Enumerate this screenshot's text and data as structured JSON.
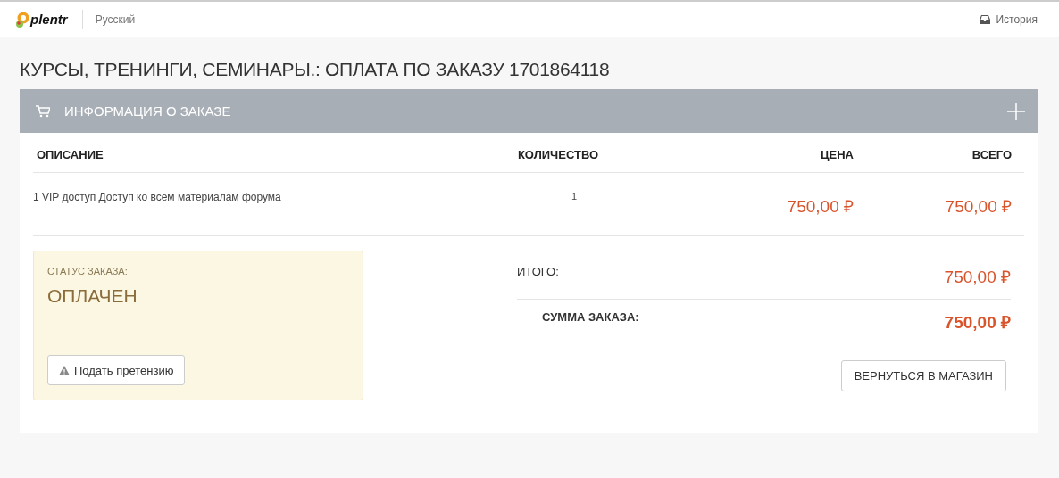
{
  "header": {
    "logo": "plentr",
    "language": "Русский",
    "history_link": "История"
  },
  "page_title": "КУРСЫ, ТРЕНИНГИ, СЕМИНАРЫ.: ОПЛАТА ПО ЗАКАЗУ 1701864118",
  "panel": {
    "title": "ИНФОРМАЦИЯ О ЗАКАЗЕ",
    "table": {
      "columns": [
        "ОПИСАНИЕ",
        "КОЛИЧЕСТВО",
        "ЦЕНА",
        "ВСЕГО"
      ],
      "rows": [
        {
          "description": "1 VIP доступ Доступ ко всем материалам форума",
          "quantity": "1",
          "price": "750,00 ₽",
          "total": "750,00 ₽"
        }
      ]
    },
    "status": {
      "label": "СТАТУС ЗАКАЗА:",
      "value": "ОПЛАЧЕН",
      "button": "Подать претензию"
    },
    "summary": [
      {
        "label": "ИТОГО:",
        "value": "750,00 ₽",
        "kind": "subtotal"
      },
      {
        "label": "СУММА ЗАКАЗА:",
        "value": "750,00 ₽",
        "kind": "grand"
      }
    ],
    "back_button": "ВЕРНУТЬСЯ В МАГАЗИН"
  }
}
